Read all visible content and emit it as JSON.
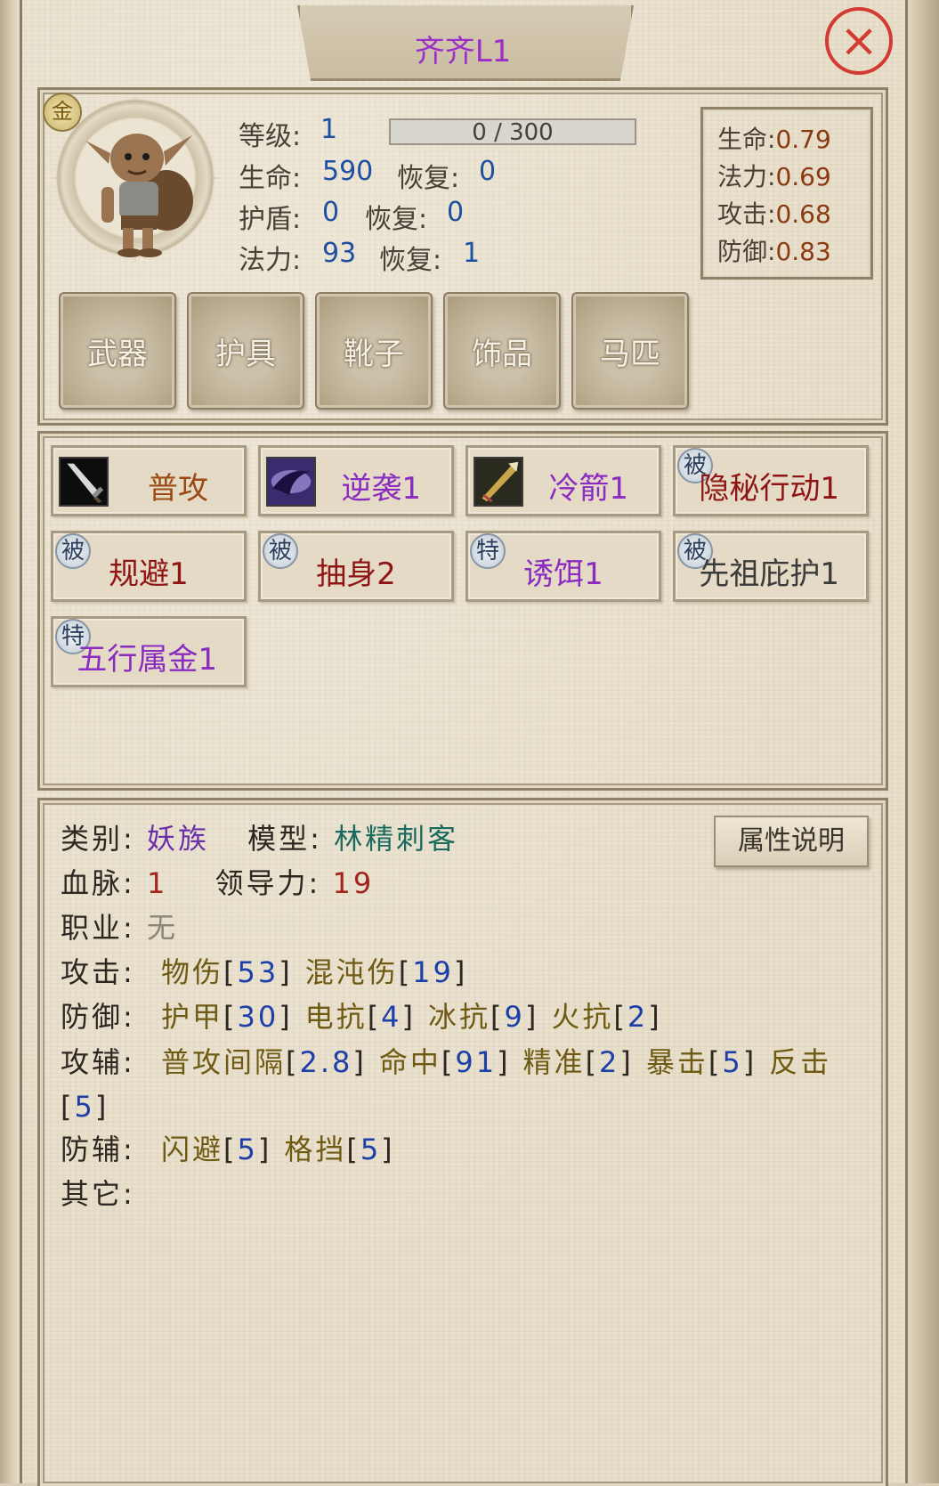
{
  "window": {
    "title": "齐齐L1",
    "close_icon": "×"
  },
  "hero": {
    "badge": "金",
    "level_label": "等级:",
    "level": "1",
    "xp_text": "0 / 300",
    "xp_progress": 0,
    "hp_label": "生命:",
    "hp": "590",
    "hp_regen_label": "恢复:",
    "hp_regen": "0",
    "shield_label": "护盾:",
    "shield": "0",
    "shield_regen_label": "恢复:",
    "shield_regen": "0",
    "mana_label": "法力:",
    "mana": "93",
    "mana_regen_label": "恢复:",
    "mana_regen": "1"
  },
  "growth": [
    {
      "label": "生命:",
      "value": "0.79"
    },
    {
      "label": "法力:",
      "value": "0.69"
    },
    {
      "label": "攻击:",
      "value": "0.68"
    },
    {
      "label": "防御:",
      "value": "0.83"
    }
  ],
  "equipment": [
    "武器",
    "护具",
    "靴子",
    "饰品",
    "马匹"
  ],
  "skills": [
    {
      "name": "普攻",
      "icon": "sword-icon",
      "badge": ""
    },
    {
      "name": "逆袭1",
      "icon": "shadow-strike-icon",
      "badge": ""
    },
    {
      "name": "冷箭1",
      "icon": "arrow-icon",
      "badge": ""
    },
    {
      "name": "隐秘行动1",
      "icon": "",
      "badge": "被"
    },
    {
      "name": "规避1",
      "icon": "",
      "badge": "被"
    },
    {
      "name": "抽身2",
      "icon": "",
      "badge": "被"
    },
    {
      "name": "诱饵1",
      "icon": "",
      "badge": "特"
    },
    {
      "name": "先祖庇护1",
      "icon": "",
      "badge": "被"
    },
    {
      "name": "五行属金1",
      "icon": "",
      "badge": "特"
    }
  ],
  "attributes": {
    "category_label": "类别:",
    "category": "妖族",
    "model_label": "模型:",
    "model": "林精刺客",
    "bloodline_label": "血脉:",
    "bloodline": "1",
    "leadership_label": "领导力:",
    "leadership": "19",
    "job_label": "职业:",
    "job": "无",
    "attack_label": "攻击:",
    "attack": [
      {
        "name": "物伤",
        "value": "53"
      },
      {
        "name": "混沌伤",
        "value": "19"
      }
    ],
    "defense_label": "防御:",
    "defense": [
      {
        "name": "护甲",
        "value": "30"
      },
      {
        "name": "电抗",
        "value": "4"
      },
      {
        "name": "冰抗",
        "value": "9"
      },
      {
        "name": "火抗",
        "value": "2"
      }
    ],
    "attack_aux_label": "攻辅:",
    "attack_aux": [
      {
        "name": "普攻间隔",
        "value": "2.8"
      },
      {
        "name": "命中",
        "value": "91"
      },
      {
        "name": "精准",
        "value": "2"
      },
      {
        "name": "暴击",
        "value": "5"
      },
      {
        "name": "反击",
        "value": "5"
      }
    ],
    "defense_aux_label": "防辅:",
    "defense_aux": [
      {
        "name": "闪避",
        "value": "5"
      },
      {
        "name": "格挡",
        "value": "5"
      }
    ],
    "other_label": "其它:",
    "explain_button": "属性说明"
  }
}
